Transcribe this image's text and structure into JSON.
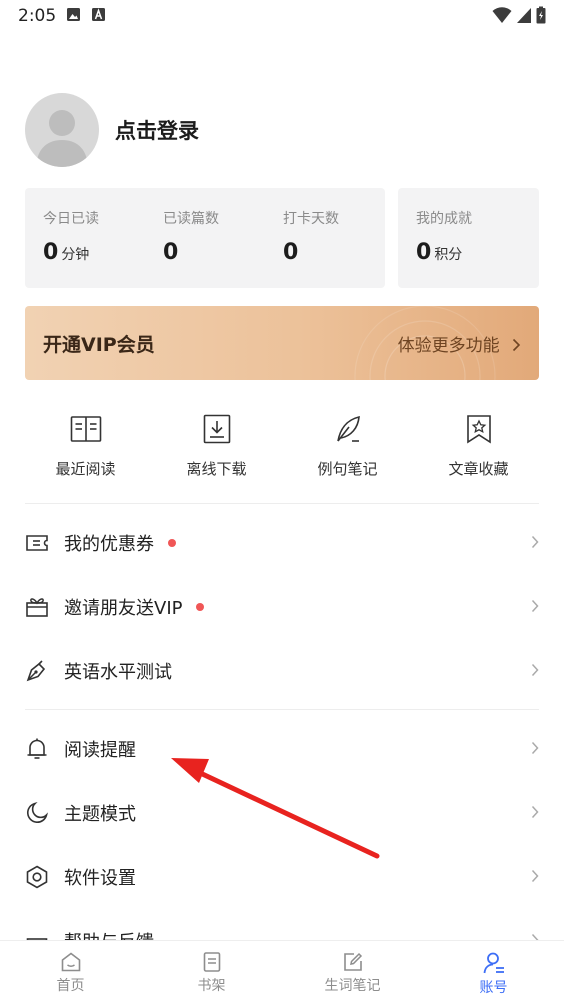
{
  "status_bar": {
    "time": "2:05"
  },
  "profile": {
    "login_text": "点击登录"
  },
  "stats": {
    "today_read": {
      "label": "今日已读",
      "value": "0",
      "unit": "分钟"
    },
    "articles_read": {
      "label": "已读篇数",
      "value": "0"
    },
    "checkin_days": {
      "label": "打卡天数",
      "value": "0"
    },
    "achievements": {
      "label": "我的成就",
      "value": "0",
      "unit": "积分"
    }
  },
  "vip": {
    "title": "开通VIP会员",
    "more": "体验更多功能"
  },
  "quick_actions": [
    {
      "label": "最近阅读",
      "icon": "open-book-icon"
    },
    {
      "label": "离线下载",
      "icon": "download-icon"
    },
    {
      "label": "例句笔记",
      "icon": "feather-icon"
    },
    {
      "label": "文章收藏",
      "icon": "bookmark-star-icon"
    }
  ],
  "menu": {
    "coupons": "我的优惠券",
    "invite": "邀请朋友送VIP",
    "level_test": "英语水平测试",
    "reminder": "阅读提醒",
    "theme": "主题模式",
    "settings": "软件设置",
    "help": "帮助与反馈"
  },
  "tab_bar": {
    "home": "首页",
    "bookshelf": "书架",
    "vocab": "生词笔记",
    "account": "账号"
  },
  "colors": {
    "accent": "#3d6ef6",
    "badge_dot": "#f05656",
    "vip_gradient_start": "#f1d2b3",
    "vip_gradient_end": "#e2a979",
    "annotation_arrow": "#e8231f"
  }
}
